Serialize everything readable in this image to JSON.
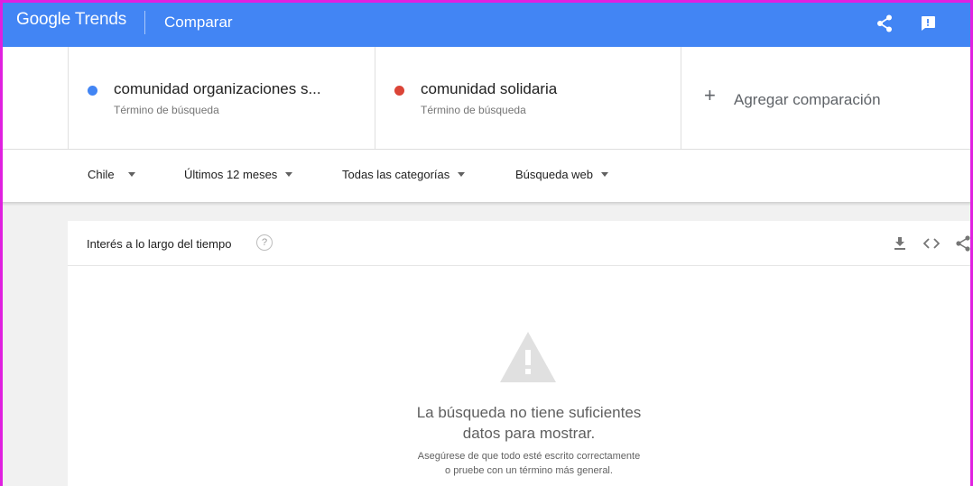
{
  "header": {
    "brand": "Google",
    "product": " Trends",
    "title": "Comparar",
    "share_icon": "share-icon",
    "feedback_icon": "feedback-icon"
  },
  "terms": [
    {
      "name": "comunidad organizaciones s...",
      "type": "Término de búsqueda",
      "color": "#4285f4"
    },
    {
      "name": "comunidad solidaria",
      "type": "Término de búsqueda",
      "color": "#db4437"
    }
  ],
  "add_comparison": "Agregar comparación",
  "filters": {
    "region": "Chile",
    "period": "Últimos 12 meses",
    "category": "Todas las categorías",
    "search_type": "Búsqueda web"
  },
  "card": {
    "title": "Interés a lo largo del tiempo",
    "help_label": "?",
    "empty_title_line1": "La búsqueda no tiene suficientes",
    "empty_title_line2": "datos para mostrar.",
    "empty_sub_line1": "Asegúrese de que todo esté escrito correctamente",
    "empty_sub_line2": "o pruebe con un término más general."
  },
  "colors": {
    "appbar": "#4285f4",
    "frame": "#e020e0"
  }
}
